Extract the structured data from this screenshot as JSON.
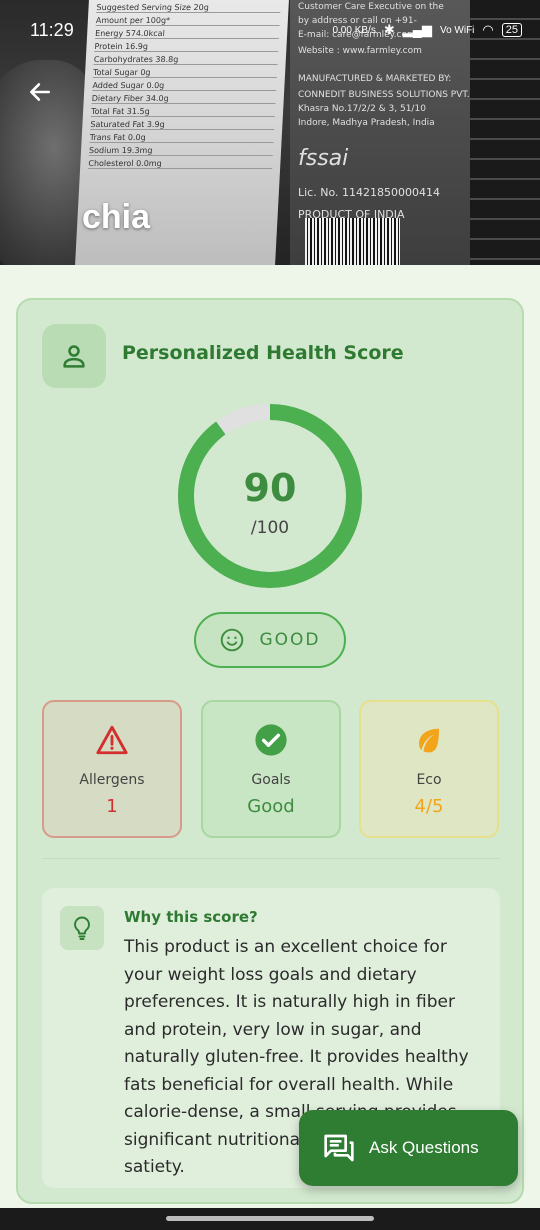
{
  "status_bar": {
    "time": "11:29",
    "net_speed": "0.00 KB/s",
    "network": "Vo WiFi",
    "battery": "25"
  },
  "product": {
    "name": "chia"
  },
  "hero_label": {
    "serving": "Suggested Serving Size  20g",
    "rows": [
      "Amount per 100g*",
      "Energy 574.0kcal",
      "Protein 16.9g",
      "Carbohydrates 38.8g",
      "Total Sugar 0g",
      "Added Sugar 0.0g",
      "Dietary Fiber 34.0g",
      "Total Fat 31.5g",
      "Saturated Fat 3.9g",
      "Trans Fat 0.0g",
      "Sodium 19.3mg",
      "Cholesterol 0.0mg"
    ],
    "pack_text": [
      "Customer Care Executive on the",
      "by address or call on +91-",
      "E-mail: care@farmley.com",
      "Website : www.farmley.com",
      "MANUFACTURED & MARKETED BY:",
      "CONNEDIT BUSINESS SOLUTIONS PVT.",
      "Khasra No.17/2/2 & 3, 51/10",
      "Indore, Madhya Pradesh, India",
      "fssai",
      "Lic. No. 11421850000414",
      "PRODUCT OF INDIA"
    ]
  },
  "score_card": {
    "title": "Personalized Health Score",
    "score": "90",
    "score_value": 90,
    "max": "/100",
    "grade": "GOOD",
    "accent_color": "#4caf50",
    "track_color": "#e0e0e0",
    "metrics": [
      {
        "label": "Allergens",
        "value": "1",
        "icon": "warning-icon",
        "color": "#d32f2f"
      },
      {
        "label": "Goals",
        "value": "Good",
        "icon": "check-circle-icon",
        "color": "#43a047"
      },
      {
        "label": "Eco",
        "value": "4/5",
        "icon": "leaf-icon",
        "color": "#f2a51a"
      }
    ],
    "why": {
      "title": "Why this score?",
      "text": "This product is an excellent choice for your weight loss goals and dietary preferences. It is naturally high in fiber and protein, very low in sugar, and naturally gluten-free. It provides healthy fats beneficial for overall health. While calorie-dense, a small serving provides significant nutritional value and promotes satiety."
    }
  },
  "fab": {
    "label": "Ask Questions",
    "icon": "chat-icon"
  }
}
